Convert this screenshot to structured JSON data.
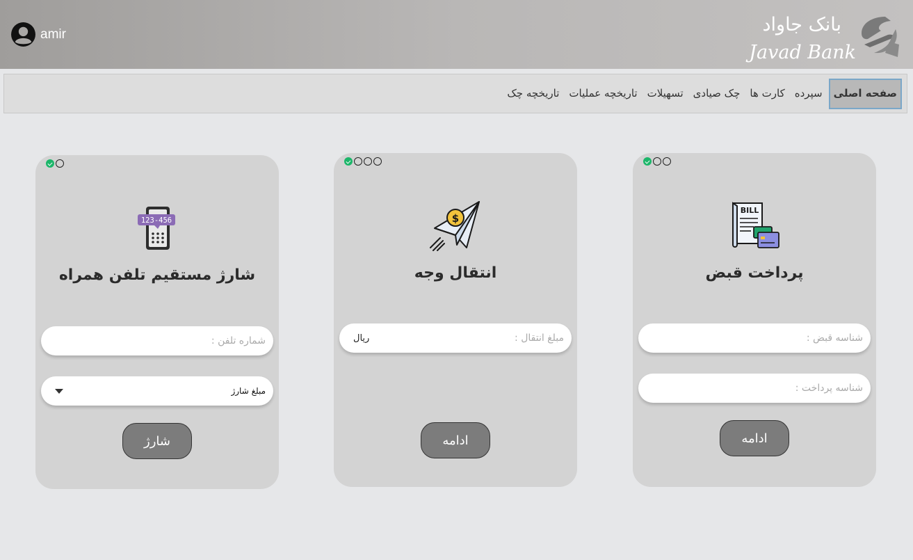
{
  "header": {
    "user_name": "amir",
    "brand_fa": "بانک جاواد",
    "brand_en": "Javad Bank"
  },
  "nav": {
    "items": [
      {
        "label": "صفحه اصلی",
        "active": true
      },
      {
        "label": "سپرده"
      },
      {
        "label": "کارت ها"
      },
      {
        "label": "چک صیادی"
      },
      {
        "label": "تسهیلات"
      },
      {
        "label": "تاریخچه عملیات"
      },
      {
        "label": "تاریخچه چک"
      }
    ]
  },
  "cards": {
    "bill": {
      "title": "پرداخت قبض",
      "icon": "bill-icon",
      "icon_text": "BILL",
      "steps": {
        "completed": 1,
        "total": 3
      },
      "bill_id_placeholder": "شناسه قبض :",
      "payment_id_placeholder": "شناسه پرداخت :",
      "button": "ادامه"
    },
    "transfer": {
      "title": "انتقال وجه",
      "icon": "paper-plane-money-icon",
      "icon_text": "$",
      "steps": {
        "completed": 1,
        "total": 4
      },
      "amount_placeholder": "مبلغ انتقال :",
      "amount_unit": "ریال",
      "button": "ادامه"
    },
    "charge": {
      "title": "شارژ مستقیم تلفن همراه",
      "icon": "mobile-topup-icon",
      "icon_text": "123-456",
      "steps": {
        "completed": 1,
        "total": 2
      },
      "phone_placeholder": "شماره تلفن :",
      "amount_select": "مبلغ شارژ",
      "button": "شارژ"
    }
  },
  "colors": {
    "card_bg": "#d3d3d3",
    "button_bg": "#7c7c7c",
    "step_done": "#1db66a",
    "active_tab_border": "#7aa7c8"
  }
}
